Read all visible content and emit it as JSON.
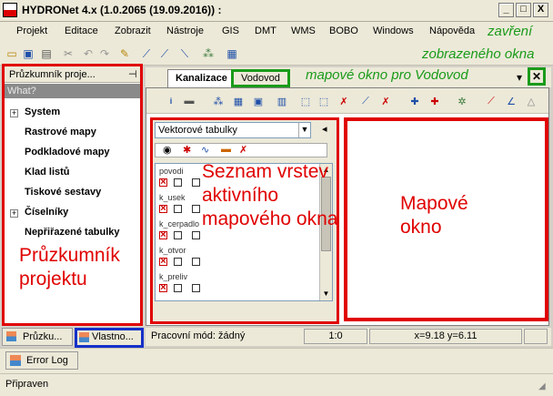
{
  "window": {
    "title": "HYDRONet 4.x (1.0.2065 (19.09.2016)) :",
    "buttons": {
      "minimize": "_",
      "maximize": "□",
      "close": "X"
    }
  },
  "menu": [
    "Projekt",
    "Editace",
    "Zobrazit",
    "Nástroje",
    "GIS",
    "DMT",
    "WMS",
    "BOBO",
    "Windows",
    "Nápověda"
  ],
  "annotations": {
    "close_line1": "zavření",
    "close_line2": "zobrazeného okna",
    "map_window": "mapové okno pro Vodovod",
    "layer_list": "Seznam vrstev aktivního mapového okna",
    "map": "Mapové okno",
    "explorer": "Průzkumník projektu"
  },
  "explorer": {
    "title": "Průzkumník proje...",
    "pin": "⊣",
    "search_placeholder": "What?",
    "items": [
      {
        "label": "System",
        "expand": "+"
      },
      {
        "label": "Rastrové mapy"
      },
      {
        "label": "Podkladové mapy"
      },
      {
        "label": "Klad listů"
      },
      {
        "label": "Tiskové sestavy"
      },
      {
        "label": "Číselníky",
        "expand": "+"
      },
      {
        "label": "Nepřiřazené tabulky"
      }
    ]
  },
  "tabs": {
    "kanalizace": "Kanalizace",
    "vodovod": "Vodovod",
    "dropdown": "▾",
    "close": "✕"
  },
  "layers": {
    "selected_group": "Vektorové tabulky",
    "collapse": "◂",
    "items": [
      "povodi",
      "k_usek",
      "k_cerpadlo",
      "k_otvor",
      "k_preliv"
    ]
  },
  "status": {
    "mode": "Pracovní mód: žádný",
    "scale": "1:0",
    "coords": "x=9.18 y=6.11"
  },
  "bottom_tabs": {
    "explorer": "Průzku...",
    "properties": "Vlastno..."
  },
  "error_log": "Error Log",
  "footer": "Připraven",
  "colors": {
    "annotation_green": "#1a9b1a",
    "annotation_red": "#e00000",
    "highlight_blue": "#1530c8"
  }
}
